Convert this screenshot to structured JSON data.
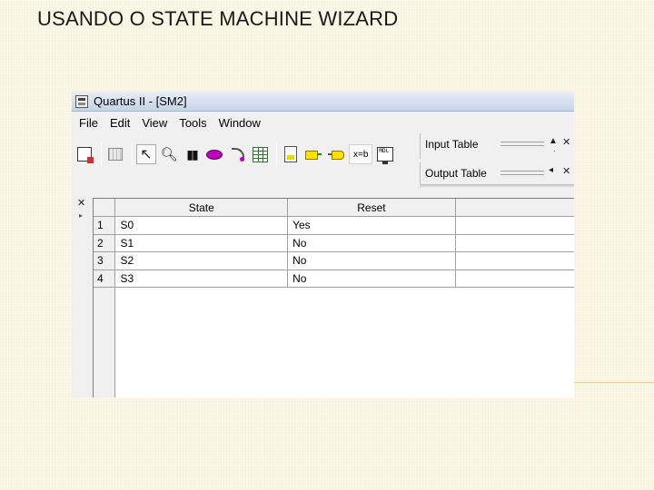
{
  "slide": {
    "title": "USANDO O STATE MACHINE WIZARD"
  },
  "window": {
    "title": "Quartus II - [SM2]"
  },
  "menu": [
    "File",
    "Edit",
    "View",
    "Tools",
    "Window"
  ],
  "toolbar": {
    "text_button": "x=b",
    "icons": [
      "new-sm-icon",
      "grid-icon",
      "select-arrow-icon",
      "zoom-icon",
      "find-icon",
      "state-tool-icon",
      "transition-tool-icon",
      "state-table-icon",
      "generate-hdl-icon",
      "input-port-icon",
      "output-port-icon",
      "equation-icon",
      "simulation-icon"
    ]
  },
  "panels": {
    "input_table": "Input Table",
    "output_table": "Output Table"
  },
  "table": {
    "columns": [
      "State",
      "Reset",
      ""
    ],
    "rows": [
      {
        "num": "1",
        "state": "S0",
        "reset": "Yes"
      },
      {
        "num": "2",
        "state": "S1",
        "reset": "No"
      },
      {
        "num": "3",
        "state": "S2",
        "reset": "No"
      },
      {
        "num": "4",
        "state": "S3",
        "reset": "No"
      }
    ]
  },
  "colors": {
    "slide_bg": "#fcf8e8",
    "accent_line": "#f0c890",
    "state_tool": "#c000c0",
    "table_tool": "#2a7a2a",
    "port_tool": "#ffe000"
  }
}
